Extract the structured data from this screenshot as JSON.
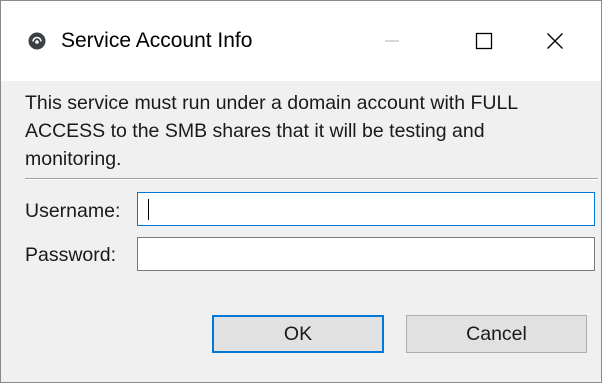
{
  "window": {
    "title": "Service Account Info",
    "controls": {
      "minimize_icon": "minimize-icon",
      "maximize_icon": "maximize-icon",
      "close_icon": "close-icon"
    }
  },
  "dialog": {
    "message": "This service must run under a domain account with FULL ACCESS to the SMB shares that it will be testing and monitoring.",
    "username": {
      "label": "Username:",
      "value": ""
    },
    "password": {
      "label": "Password:",
      "value": ""
    },
    "buttons": {
      "ok": "OK",
      "cancel": "Cancel"
    }
  },
  "colors": {
    "focus_accent": "#0078d7",
    "dialog_background": "#f0f0f0",
    "titlebar_background": "#ffffff",
    "button_face": "#e1e1e1"
  }
}
